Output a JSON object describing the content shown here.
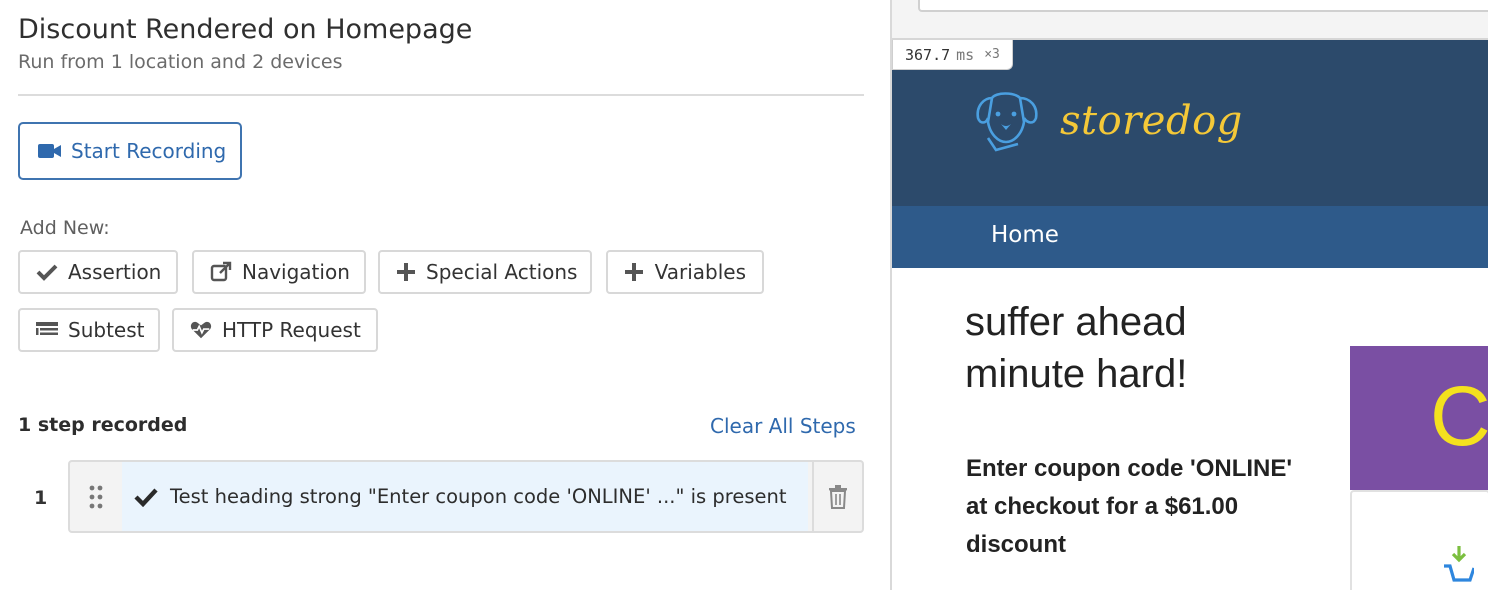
{
  "test": {
    "title": "Discount Rendered on Homepage",
    "subtitle": "Run from 1 location and 2 devices"
  },
  "recorder": {
    "start_label": "Start Recording",
    "start_icon": "video-camera-icon"
  },
  "add_new": {
    "label": "Add New:",
    "buttons": [
      {
        "label": "Assertion",
        "icon": "check-icon"
      },
      {
        "label": "Navigation",
        "icon": "external-link-icon"
      },
      {
        "label": "Special Actions",
        "icon": "plus-icon"
      },
      {
        "label": "Variables",
        "icon": "plus-icon"
      },
      {
        "label": "Subtest",
        "icon": "list-icon"
      },
      {
        "label": "HTTP Request",
        "icon": "heartbeat-icon"
      }
    ]
  },
  "steps": {
    "count_label": "1 step recorded",
    "clear_label": "Clear All Steps",
    "items": [
      {
        "number": "1",
        "text": "Test heading strong \"Enter coupon code 'ONLINE' ...\" is present",
        "status": "passed"
      }
    ]
  },
  "preview": {
    "timing_value": "367.7",
    "timing_unit": "ms",
    "timing_multiplier": "×3",
    "brand": "storedog",
    "nav_home": "Home",
    "hero_line1": "suffer ahead",
    "hero_line2": "minute hard!",
    "coupon_text": "Enter coupon code 'ONLINE' at checkout for a $61.00 discount",
    "promo_partial": "C",
    "colors": {
      "header_bg": "#2c4a6b",
      "nav_bg": "#2e5a8a",
      "brand": "#f4c838",
      "promo_bg": "#7a4fa3",
      "accent": "#2f69ad"
    }
  }
}
